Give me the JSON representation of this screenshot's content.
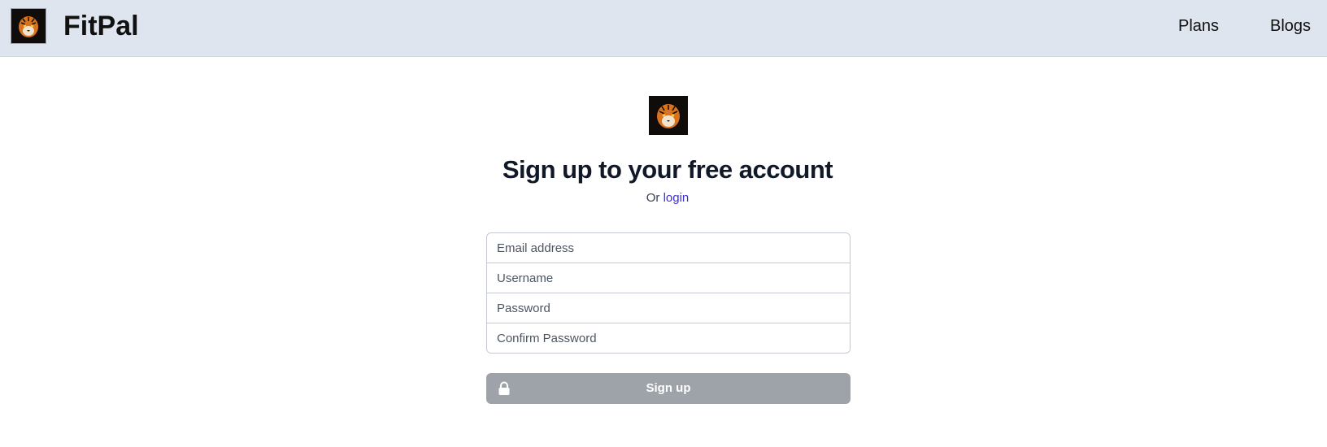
{
  "header": {
    "brand": "FitPal",
    "logo_icon": "tiger-face-icon",
    "nav": [
      {
        "label": "Plans"
      },
      {
        "label": "Blogs"
      }
    ]
  },
  "main": {
    "logo_icon": "tiger-face-icon",
    "title": "Sign up to your free account",
    "subtitle_prefix": "Or",
    "login_link": "login",
    "fields": {
      "email_placeholder": "Email address",
      "username_placeholder": "Username",
      "password_placeholder": "Password",
      "confirm_placeholder": "Confirm Password"
    },
    "signup_label": "Sign up",
    "signup_icon": "lock-icon"
  },
  "colors": {
    "navbar_bg": "#dfe5ee",
    "link": "#3b2fd6",
    "button_disabled": "#9ea3a9"
  }
}
